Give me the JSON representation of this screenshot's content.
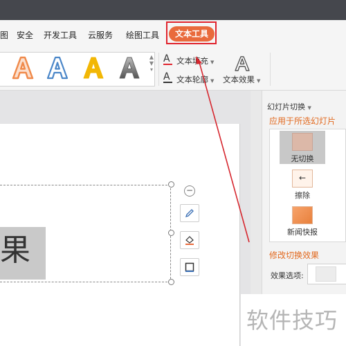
{
  "menu": {
    "items": [
      "图",
      "安全",
      "开发工具",
      "云服务",
      "绘图工具"
    ],
    "active": "文本工具"
  },
  "ribbon": {
    "wordart_samples": [
      {
        "glyph": "A",
        "color": "#f08a4b"
      },
      {
        "glyph": "A",
        "color": "#4a86c8"
      },
      {
        "glyph": "A",
        "color": "#f2b705"
      },
      {
        "glyph": "A",
        "color": "#888888"
      }
    ],
    "text_fill": "文本填充",
    "text_outline": "文本轮廓",
    "text_effect": "文本效果",
    "glyph": "A"
  },
  "canvas": {
    "text": "果"
  },
  "panel": {
    "title": "幻灯片切换",
    "apply_label": "应用于所选幻灯片",
    "transitions": [
      "无切换",
      "擦除",
      "新闻快报"
    ],
    "modify_label": "修改切换效果",
    "effect_option_label": "效果选项:"
  },
  "watermark": "软件技巧",
  "colors": {
    "accent": "#e96a3c",
    "highlight_border": "#e0232d",
    "panel_orange": "#e2691f"
  }
}
